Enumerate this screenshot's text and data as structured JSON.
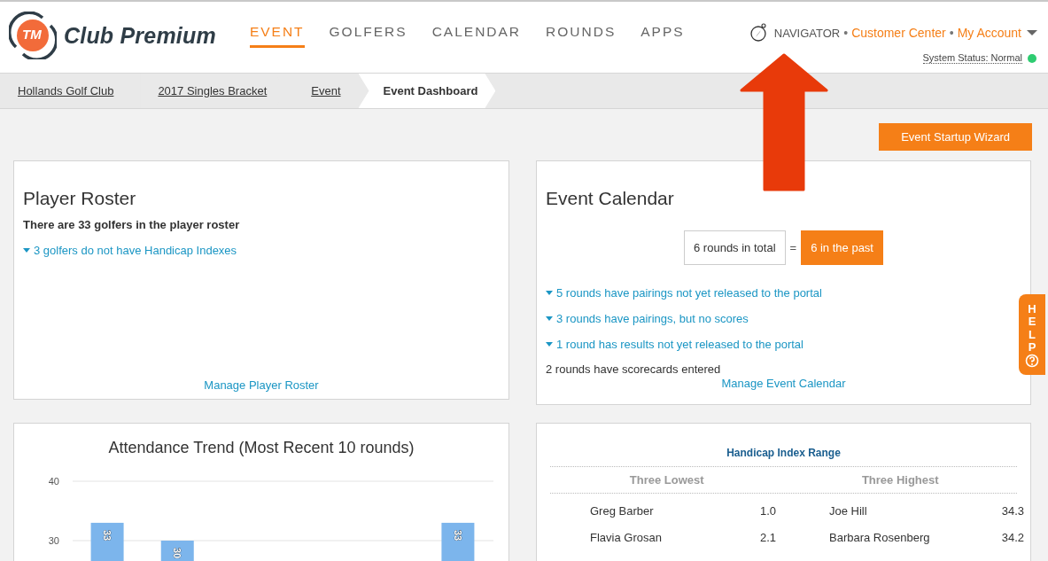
{
  "logo": {
    "badge": "TM",
    "name": "Club Premium"
  },
  "nav": [
    {
      "label": "EVENT",
      "selected": true
    },
    {
      "label": "GOLFERS",
      "selected": false
    },
    {
      "label": "CALENDAR",
      "selected": false
    },
    {
      "label": "ROUNDS",
      "selected": false
    },
    {
      "label": "APPS",
      "selected": false
    }
  ],
  "utility": {
    "navigator": "NAVIGATOR",
    "separators": [
      "•",
      "•"
    ],
    "links": [
      "Customer Center",
      "My Account"
    ]
  },
  "system_status": {
    "label": "System Status: Normal",
    "color": "#2ecc71"
  },
  "breadcrumbs": [
    {
      "label": "Hollands Golf Club",
      "selected": false
    },
    {
      "label": "2017 Singles Bracket",
      "selected": false
    },
    {
      "label": "Event",
      "selected": false
    },
    {
      "label": "Event Dashboard",
      "selected": true
    }
  ],
  "wizard_button": "Event Startup Wizard",
  "player_roster": {
    "title": "Player Roster",
    "summary": "There are 33 golfers in the player roster",
    "alerts": [
      "3 golfers do not have Handicap Indexes"
    ],
    "link": "Manage Player Roster"
  },
  "event_calendar": {
    "title": "Event Calendar",
    "total": "6 rounds in total",
    "equals": "=",
    "past": "6 in the past",
    "alerts": [
      "5 rounds have pairings not yet released to the portal",
      "3 rounds have pairings, but no scores",
      "1 round has results not yet released to the portal"
    ],
    "note": "2 rounds have scorecards entered",
    "link": "Manage Event Calendar"
  },
  "attendance": {
    "chart_data": {
      "type": "bar",
      "title": "Attendance Trend (Most Recent 10 rounds)",
      "series": [
        {
          "color": "#7cb5ec",
          "values": [
            33,
            30,
            null,
            null,
            null,
            33
          ]
        }
      ],
      "ylim": [
        0,
        40
      ],
      "yticks": [
        30,
        40
      ],
      "data_labels": true
    }
  },
  "handicap": {
    "title": "Handicap Index Range",
    "columns": [
      "Three Lowest",
      "Three Highest"
    ],
    "rows": [
      {
        "low_name": "Greg Barber",
        "low_value": "1.0",
        "high_name": "Joe Hill",
        "high_value": "34.3"
      },
      {
        "low_name": "Flavia Grosan",
        "low_value": "2.1",
        "high_name": "Barbara Rosenberg",
        "high_value": "34.2"
      }
    ]
  },
  "help_tab": {
    "label": "HELP"
  }
}
